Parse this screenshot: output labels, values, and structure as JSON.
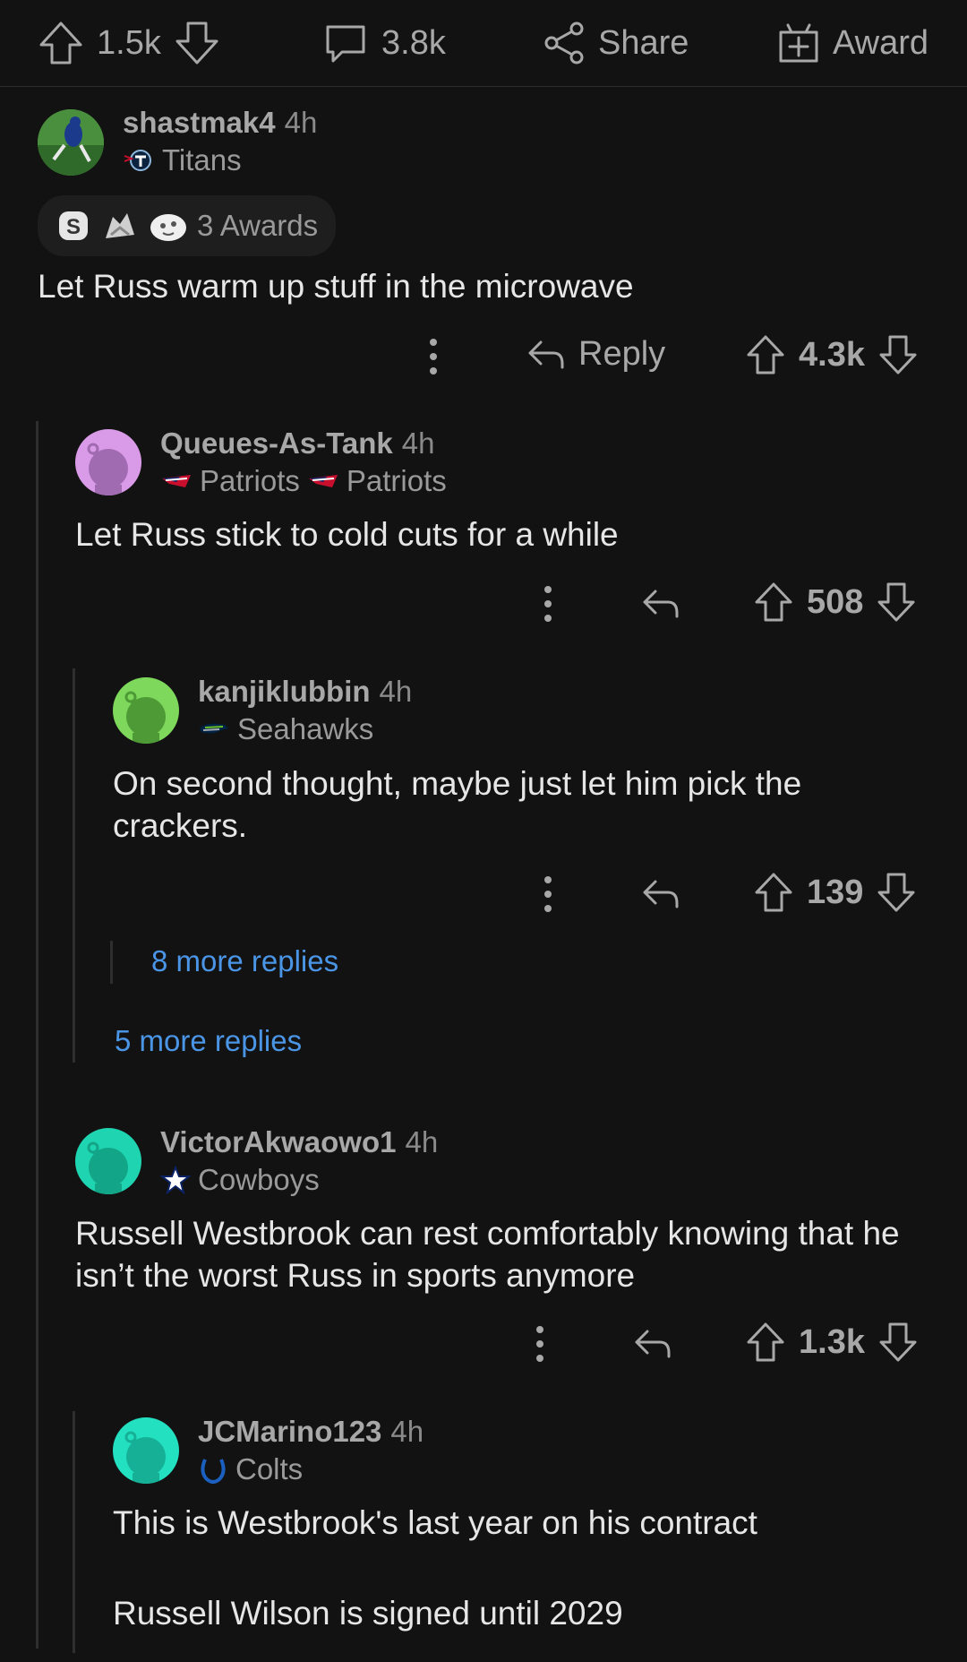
{
  "post_bar": {
    "upvotes": "1.5k",
    "comments": "3.8k",
    "share_label": "Share",
    "award_label": "Award"
  },
  "comments": [
    {
      "username": "shastmak4",
      "time": "4h",
      "flair": "Titans",
      "awards_label": "3 Awards",
      "text": "Let Russ warm up stuff in the microwave",
      "reply_label": "Reply",
      "votes": "4.3k"
    },
    {
      "username": "Queues-As-Tank",
      "time": "4h",
      "flair1": "Patriots",
      "flair2": "Patriots",
      "text": "Let Russ stick to cold cuts for a while",
      "votes": "508"
    },
    {
      "username": "kanjiklubbin",
      "time": "4h",
      "flair": "Seahawks",
      "text": "On second thought, maybe just let him pick the crackers.",
      "votes": "139",
      "more_replies_nested": "8 more replies",
      "more_replies": "5 more replies"
    },
    {
      "username": "VictorAkwaowo1",
      "time": "4h",
      "flair": "Cowboys",
      "text": "Russell Westbrook can rest comfortably knowing that he isn’t the worst Russ in sports anymore",
      "votes": "1.3k"
    },
    {
      "username": "JCMarino123",
      "time": "4h",
      "flair": "Colts",
      "text1": "This is Westbrook's last year on his contract",
      "text2": "Russell Wilson is signed until 2029"
    }
  ],
  "colors": {
    "background": "#121212",
    "link": "#4b95e6",
    "avatar_pink": "#d99ae8",
    "avatar_green": "#7dd85b",
    "avatar_teal": "#1fd4b0",
    "avatar_teal2": "#22e0c0"
  }
}
